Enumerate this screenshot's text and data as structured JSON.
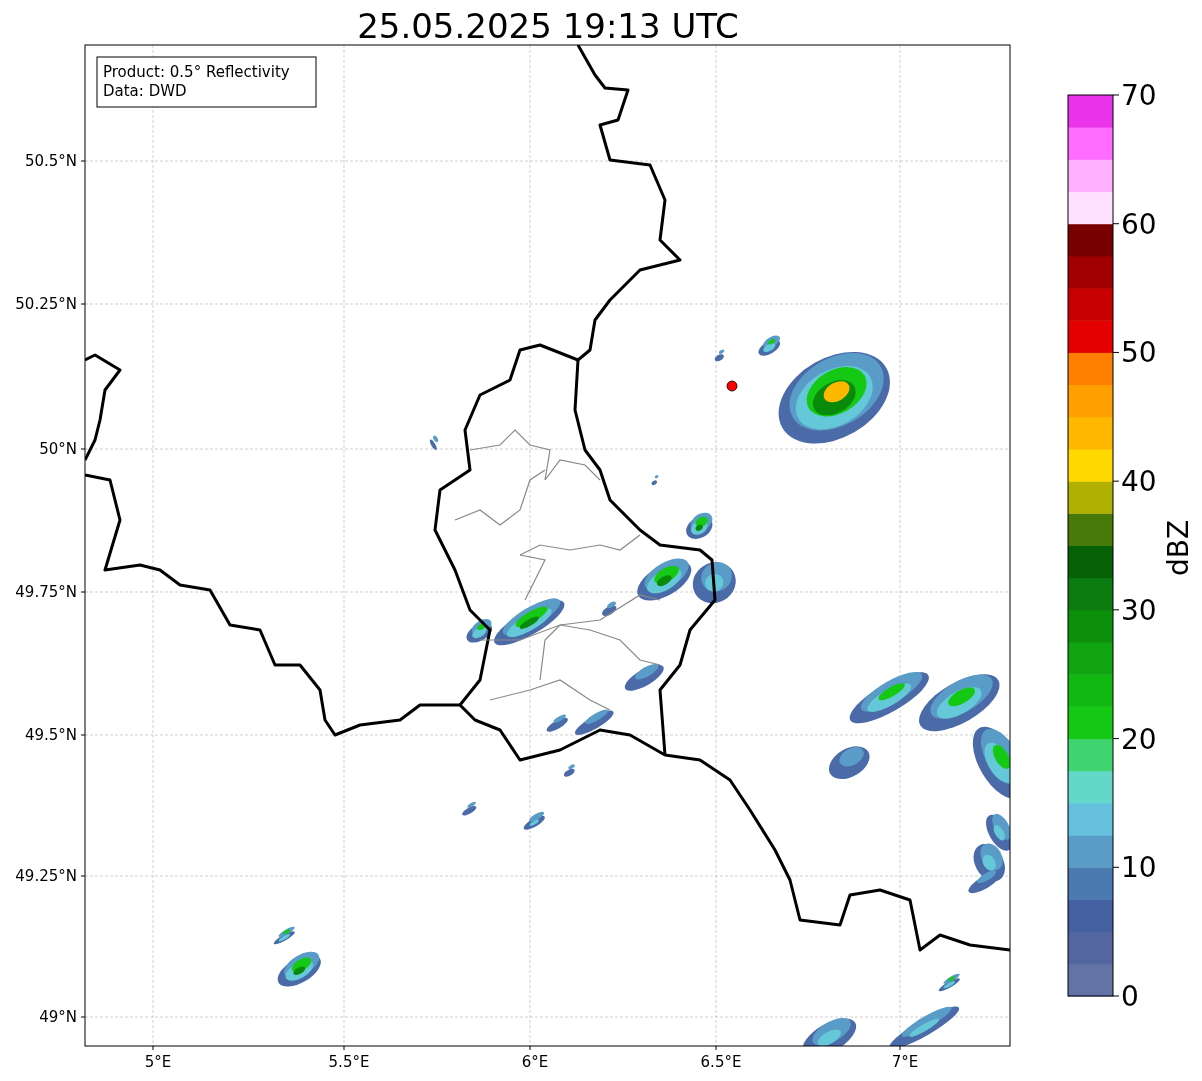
{
  "title": "25.05.2025 19:13 UTC",
  "info_box": {
    "lines": [
      "Product: 0.5° Reflectivity",
      "Data: DWD"
    ]
  },
  "y_ticks": [
    "50.5°N",
    "50.25°N",
    "50°N",
    "49.75°N",
    "49.5°N",
    "49.25°N",
    "49°N"
  ],
  "x_ticks": [
    "5°E",
    "5.5°E",
    "6°E",
    "6.5°E",
    "7°E"
  ],
  "colorbar": {
    "label": "dBZ",
    "ticks": [
      "70",
      "60",
      "50",
      "40",
      "30",
      "20",
      "10",
      "0"
    ],
    "bands": [
      {
        "color": "#6373a6"
      },
      {
        "color": "#5366a0"
      },
      {
        "color": "#4460a0"
      },
      {
        "color": "#4a7ab0"
      },
      {
        "color": "#5a9cc8"
      },
      {
        "color": "#64c0dc"
      },
      {
        "color": "#64d8c8"
      },
      {
        "color": "#40d470"
      },
      {
        "color": "#14c814"
      },
      {
        "color": "#12b812"
      },
      {
        "color": "#10a410"
      },
      {
        "color": "#0c900c"
      },
      {
        "color": "#0c7c10"
      },
      {
        "color": "#066006"
      },
      {
        "color": "#487a0a"
      },
      {
        "color": "#b0b000"
      },
      {
        "color": "#ffd800"
      },
      {
        "color": "#ffb800"
      },
      {
        "color": "#ffa000"
      },
      {
        "color": "#ff8000"
      },
      {
        "color": "#e40000"
      },
      {
        "color": "#c80000"
      },
      {
        "color": "#a00000"
      },
      {
        "color": "#780000"
      },
      {
        "color": "#ffe0ff"
      },
      {
        "color": "#ffb0ff"
      },
      {
        "color": "#ff6cff"
      },
      {
        "color": "#ea33ea"
      }
    ]
  }
}
